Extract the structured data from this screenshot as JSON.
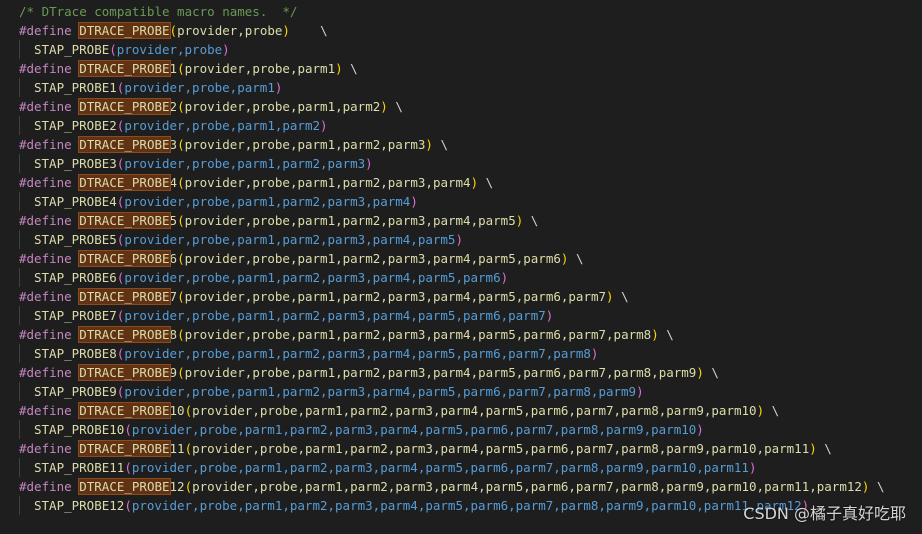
{
  "comment": "/* DTrace compatible macro names.  */",
  "keyword": "#define",
  "macro_prefix": "DTRACE_PROBE",
  "backslash": "\\",
  "defines": [
    {
      "num": "",
      "params": "provider,probe",
      "call": "STAP_PROBE",
      "args": "provider,probe"
    },
    {
      "num": "1",
      "params": "provider,probe,parm1",
      "call": "STAP_PROBE1",
      "args": "provider,probe,parm1"
    },
    {
      "num": "2",
      "params": "provider,probe,parm1,parm2",
      "call": "STAP_PROBE2",
      "args": "provider,probe,parm1,parm2"
    },
    {
      "num": "3",
      "params": "provider,probe,parm1,parm2,parm3",
      "call": "STAP_PROBE3",
      "args": "provider,probe,parm1,parm2,parm3"
    },
    {
      "num": "4",
      "params": "provider,probe,parm1,parm2,parm3,parm4",
      "call": "STAP_PROBE4",
      "args": "provider,probe,parm1,parm2,parm3,parm4"
    },
    {
      "num": "5",
      "params": "provider,probe,parm1,parm2,parm3,parm4,parm5",
      "call": "STAP_PROBE5",
      "args": "provider,probe,parm1,parm2,parm3,parm4,parm5"
    },
    {
      "num": "6",
      "params": "provider,probe,parm1,parm2,parm3,parm4,parm5,parm6",
      "call": "STAP_PROBE6",
      "args": "provider,probe,parm1,parm2,parm3,parm4,parm5,parm6"
    },
    {
      "num": "7",
      "params": "provider,probe,parm1,parm2,parm3,parm4,parm5,parm6,parm7",
      "call": "STAP_PROBE7",
      "args": "provider,probe,parm1,parm2,parm3,parm4,parm5,parm6,parm7"
    },
    {
      "num": "8",
      "params": "provider,probe,parm1,parm2,parm3,parm4,parm5,parm6,parm7,parm8",
      "call": "STAP_PROBE8",
      "args": "provider,probe,parm1,parm2,parm3,parm4,parm5,parm6,parm7,parm8"
    },
    {
      "num": "9",
      "params": "provider,probe,parm1,parm2,parm3,parm4,parm5,parm6,parm7,parm8,parm9",
      "call": "STAP_PROBE9",
      "args": "provider,probe,parm1,parm2,parm3,parm4,parm5,parm6,parm7,parm8,parm9"
    },
    {
      "num": "10",
      "params": "provider,probe,parm1,parm2,parm3,parm4,parm5,parm6,parm7,parm8,parm9,parm10",
      "call": "STAP_PROBE10",
      "args": "provider,probe,parm1,parm2,parm3,parm4,parm5,parm6,parm7,parm8,parm9,parm10"
    },
    {
      "num": "11",
      "params": "provider,probe,parm1,parm2,parm3,parm4,parm5,parm6,parm7,parm8,parm9,parm10,parm11",
      "call": "STAP_PROBE11",
      "args": "provider,probe,parm1,parm2,parm3,parm4,parm5,parm6,parm7,parm8,parm9,parm10,parm11"
    },
    {
      "num": "12",
      "params": "provider,probe,parm1,parm2,parm3,parm4,parm5,parm6,parm7,parm8,parm9,parm10,parm11,parm12",
      "call": "STAP_PROBE12",
      "args": "provider,probe,parm1,parm2,parm3,parm4,parm5,parm6,parm7,parm8,parm9,parm10,parm11,parm12"
    }
  ],
  "watermark": "CSDN @橘子真好吃耶"
}
